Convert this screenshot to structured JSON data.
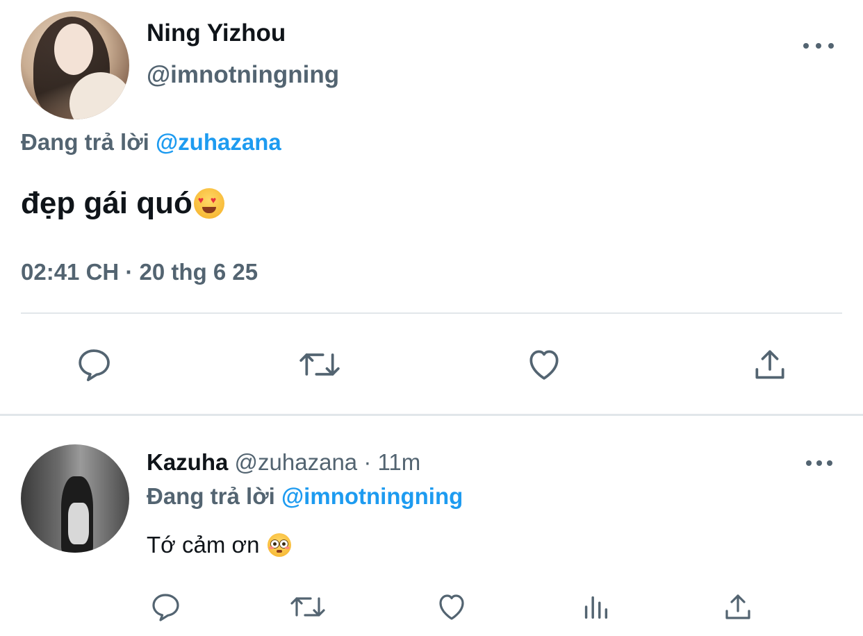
{
  "main_tweet": {
    "author_name": "Ning Yizhou",
    "author_handle": "@imnotningning",
    "replying_prefix": "Đang trả lời",
    "replying_to": "@zuhazana",
    "text": "đẹp gái quó",
    "emoji": "heart-eyes-emoji",
    "timestamp": "02:41 CH · 20 thg 6 25",
    "actions": [
      "reply-icon",
      "retweet-icon",
      "like-icon",
      "share-icon"
    ]
  },
  "reply_tweet": {
    "author_name": "Kazuha",
    "author_handle": "@zuhazana",
    "separator": "·",
    "time_ago": "11m",
    "replying_prefix": "Đang trả lời",
    "replying_to": "@imnotningning",
    "text": "Tớ cảm ơn",
    "emoji": "flushed-emoji",
    "actions": [
      "reply-icon",
      "retweet-icon",
      "like-icon",
      "views-icon",
      "share-icon"
    ]
  },
  "colors": {
    "text_primary": "#0f1419",
    "text_secondary": "#536471",
    "mention": "#1d9bf0",
    "divider": "#e1e6ea"
  }
}
